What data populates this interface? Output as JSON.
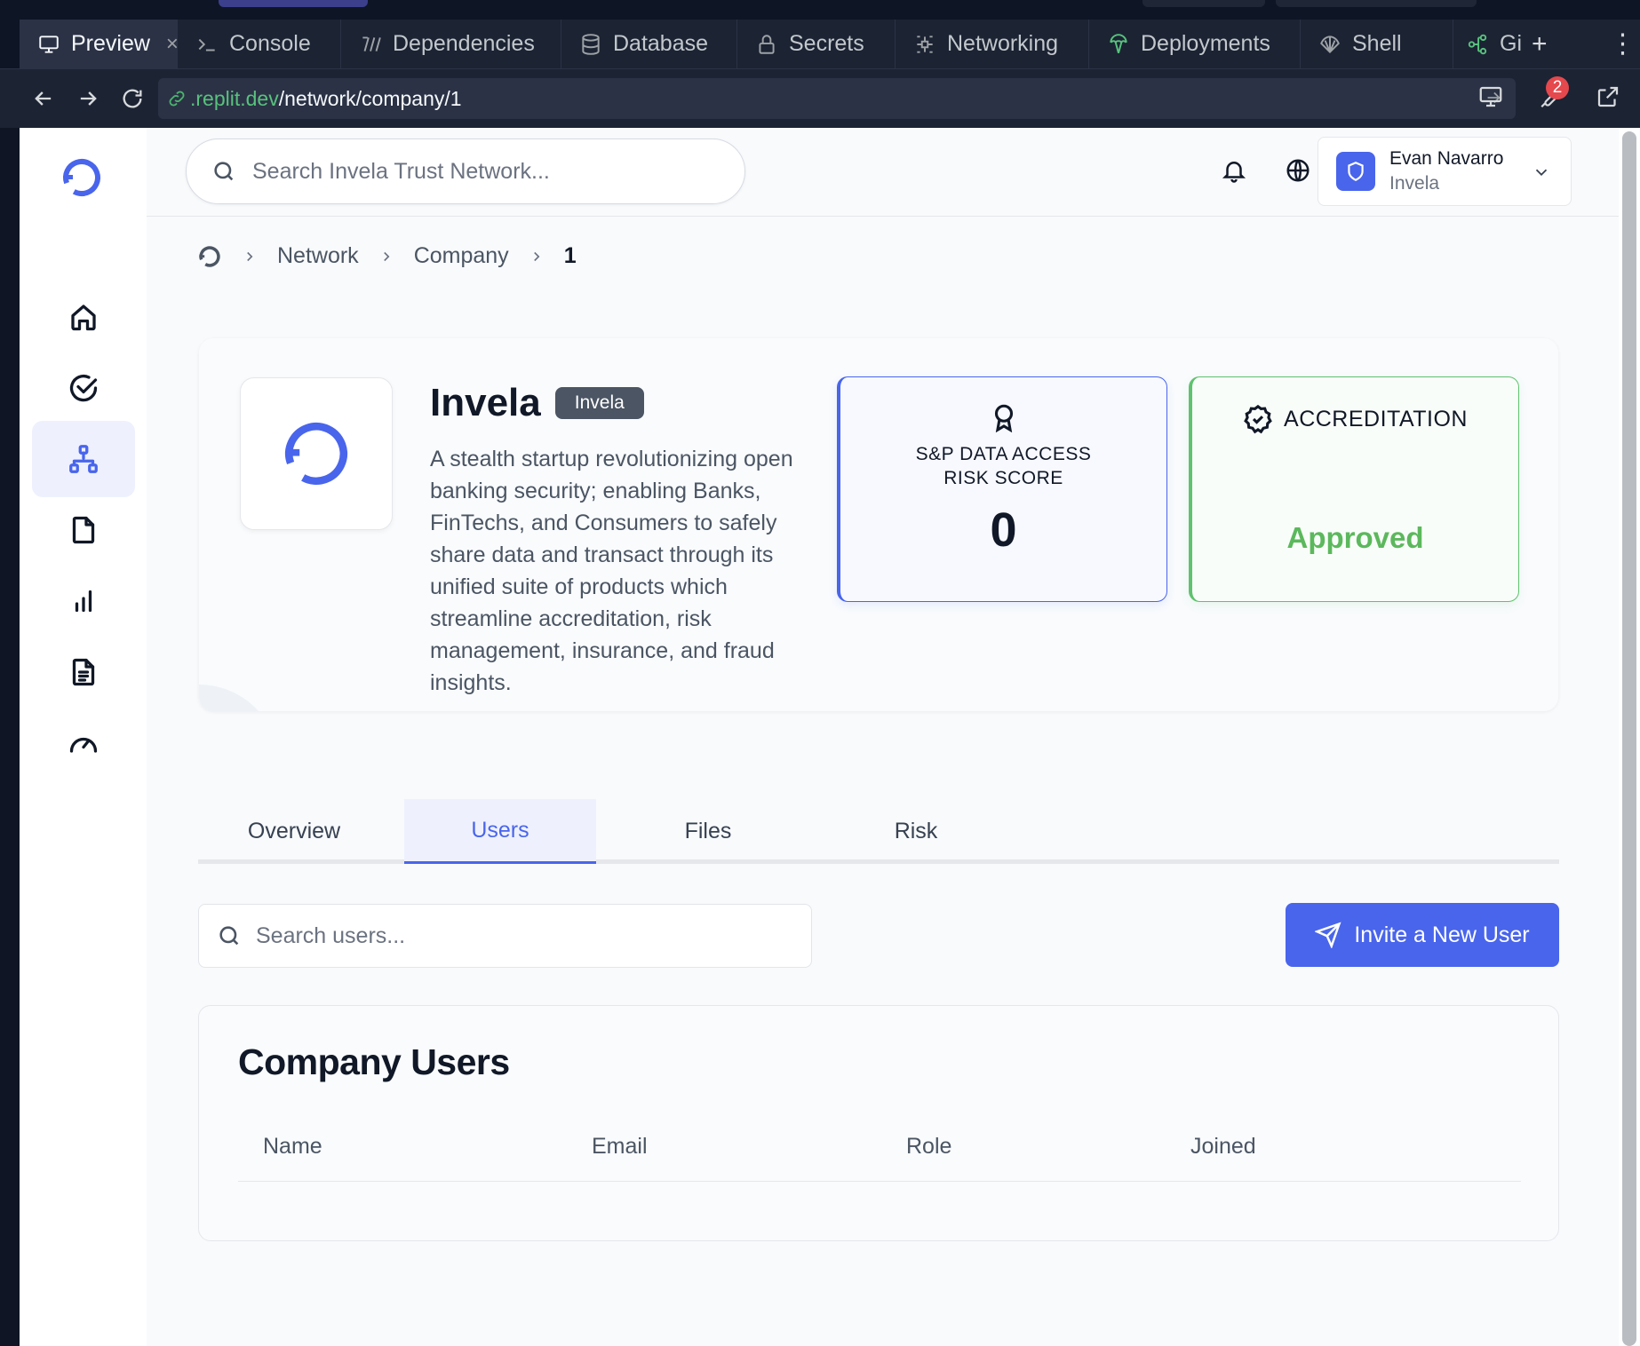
{
  "ide": {
    "tabs": [
      {
        "label": "Preview",
        "icon": "monitor-icon",
        "active": true
      },
      {
        "label": "Console",
        "icon": "terminal-icon"
      },
      {
        "label": "Dependencies",
        "icon": "dependencies-icon"
      },
      {
        "label": "Database",
        "icon": "database-icon"
      },
      {
        "label": "Secrets",
        "icon": "lock-icon"
      },
      {
        "label": "Networking",
        "icon": "network-icon"
      },
      {
        "label": "Deployments",
        "icon": "deployments-icon"
      },
      {
        "label": "Shell",
        "icon": "shell-icon"
      },
      {
        "label": "Gi",
        "icon": "git-icon"
      }
    ],
    "close_glyph": "×",
    "add_glyph": "+",
    "more_glyph": "⋮",
    "url": {
      "host": ".replit.dev",
      "path": "/network/company/1"
    },
    "devtools_badge": "2"
  },
  "app": {
    "search_placeholder": "Search Invela Trust Network...",
    "user": {
      "name": "Evan Navarro",
      "org": "Invela"
    },
    "breadcrumb": [
      "Network",
      "Company",
      "1"
    ],
    "company": {
      "name": "Invela",
      "tag": "Invela",
      "description": "A stealth startup revolutionizing open banking security; enabling Banks, FinTechs, and Consumers to safely share data and transact through its unified suite of products which streamline accreditation, risk management, insurance, and fraud insights."
    },
    "risk": {
      "label_line1": "S&P DATA ACCESS",
      "label_line2": "RISK SCORE",
      "value": "0"
    },
    "accreditation": {
      "label": "ACCREDITATION",
      "status": "Approved"
    },
    "tabs": [
      {
        "label": "Overview"
      },
      {
        "label": "Users",
        "active": true
      },
      {
        "label": "Files"
      },
      {
        "label": "Risk"
      }
    ],
    "users_search_placeholder": "Search users...",
    "invite_label": "Invite a New User",
    "users_card": {
      "title": "Company Users",
      "columns": [
        "Name",
        "Email",
        "Role",
        "Joined"
      ]
    }
  },
  "colors": {
    "accent": "#4965ec",
    "approved": "#5cb85c",
    "ide_bg": "#1c2333"
  }
}
